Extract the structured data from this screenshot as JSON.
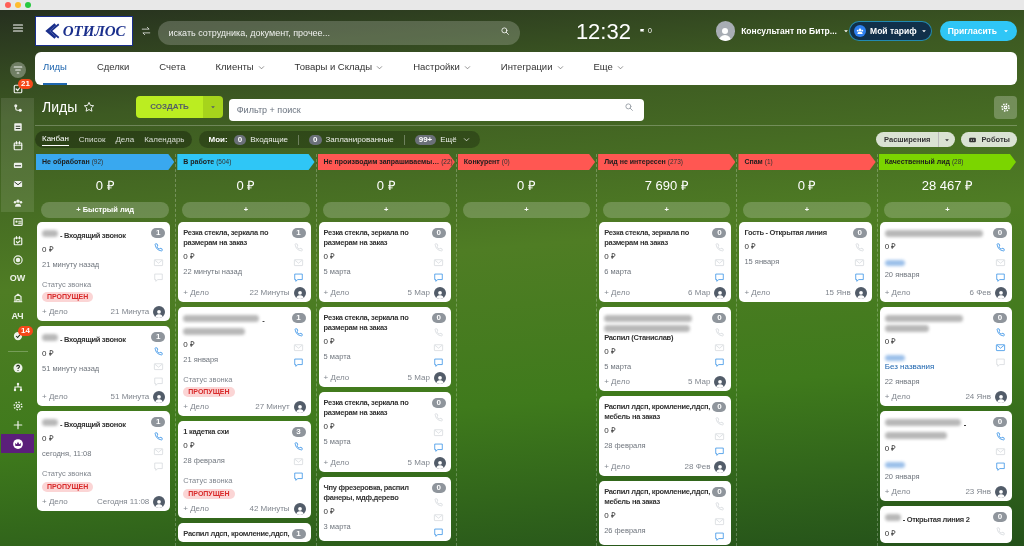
{
  "header": {
    "logo": "ОТИЛОС",
    "search": {
      "placeholder": "искать сотрудника, документ, прочее..."
    },
    "clock": "12:32",
    "flag_count": "0",
    "user": "Консультант по Битр...",
    "tariff": "Мой тариф",
    "invite": "Пригласить"
  },
  "sidebar": [
    {
      "selected": false
    },
    {
      "selected": false,
      "badge": "21"
    },
    {
      "selected": false
    },
    {
      "selected": false
    },
    {
      "selected": false
    },
    {
      "selected": false
    },
    {
      "selected": false
    },
    {
      "selected": false
    },
    {
      "selected": false
    },
    {
      "selected": false
    },
    {
      "selected": false
    },
    {
      "selected": false,
      "label": "OW"
    },
    {
      "selected": false
    },
    {
      "selected": false,
      "label": "АЧ"
    },
    {
      "selected": false,
      "badge": "14"
    },
    {
      "selected": false
    },
    {
      "selected": false
    },
    {
      "selected": false
    },
    {
      "selected": false
    },
    {
      "selected": true
    }
  ],
  "nav": [
    {
      "label": "Лиды",
      "selected": true,
      "menu": false
    },
    {
      "label": "Сделки",
      "selected": false,
      "menu": false
    },
    {
      "label": "Счета",
      "selected": false,
      "menu": false
    },
    {
      "label": "Клиенты",
      "selected": false,
      "menu": true
    },
    {
      "label": "Товары и Склады",
      "selected": false,
      "menu": true
    },
    {
      "label": "Настройки",
      "selected": false,
      "menu": true
    },
    {
      "label": "Интеграции",
      "selected": false,
      "menu": true
    },
    {
      "label": "Еще",
      "selected": false,
      "menu": true
    }
  ],
  "page": {
    "title": "Лиды",
    "create": "СОЗДАТЬ",
    "filter": {
      "placeholder": "Фильтр + поиск"
    }
  },
  "views": [
    {
      "label": "Канбан",
      "selected": true
    },
    {
      "label": "Список",
      "selected": false
    },
    {
      "label": "Дела",
      "selected": false
    },
    {
      "label": "Календарь",
      "selected": false
    }
  ],
  "counters": {
    "label": "Мои:",
    "items": [
      {
        "count": "0",
        "label": "Входящие"
      },
      {
        "count": "0",
        "label": "Запланированные"
      },
      {
        "count": "99+",
        "label": "Ещё"
      }
    ]
  },
  "extensions": "Расширения",
  "robots": "Роботы",
  "columns": [
    {
      "title": "Не обработан",
      "count": "(92)",
      "color": "#39a8ef",
      "sum": "0 ₽",
      "add": "+ Быстрый лид",
      "cards": [
        {
          "kind": "prefix",
          "title": "- Входящий звонок",
          "counter": "1",
          "amount": "0 ₽",
          "date": "21 минуту назад",
          "status_label": "Статус звонка",
          "status": "ПРОПУЩЕН",
          "phone": true,
          "mail": false,
          "chat": false,
          "task": "+ Дело",
          "time": "21 Минута"
        },
        {
          "kind": "prefix",
          "title": "- Входящий звонок",
          "counter": "1",
          "amount": "0 ₽",
          "date": "51 минуту назад",
          "phone": true,
          "mail": false,
          "chat": false,
          "task": "+ Дело",
          "time": "51 Минута"
        },
        {
          "kind": "prefix",
          "title": "- Входящий звонок",
          "counter": "1",
          "amount": "0 ₽",
          "date": "сегодня, 11:08",
          "status_label": "Статус звонка",
          "status": "ПРОПУЩЕН",
          "phone": true,
          "mail": false,
          "chat": false,
          "task": "+ Дело",
          "time": "Сегодня 11:08"
        }
      ]
    },
    {
      "title": "В работе",
      "count": "(504)",
      "color": "#2fc6f6",
      "sum": "0 ₽",
      "add": "+",
      "cards": [
        {
          "kind": "plain",
          "title": "Резка стекла, зеркала по размерам на заказ",
          "counter": "1",
          "amount": "0 ₽",
          "date": "22 минуты назад",
          "phone": false,
          "mail": false,
          "chat": true,
          "task": "+ Дело",
          "time": "22 Минуты"
        },
        {
          "kind": "middle",
          "title": "-",
          "counter": "1",
          "amount": "0 ₽",
          "date": "21 января",
          "status_label": "Статус звонка",
          "status": "ПРОПУЩЕН",
          "phone": true,
          "mail": false,
          "chat": true,
          "task": "+ Дело",
          "time": "27 Минут"
        },
        {
          "kind": "plain",
          "title": "1 кадетка схи",
          "counter": "3",
          "amount": "0 ₽",
          "date": "28 февраля",
          "status_label": "Статус звонка",
          "status": "ПРОПУЩЕН",
          "phone": true,
          "mail": false,
          "chat": true,
          "task": "+ Дело",
          "time": "42 Минуты"
        },
        {
          "kind": "plain",
          "title": "Распил лдсп, кромление,лдсп,",
          "counter": "1"
        }
      ]
    },
    {
      "title": "Не производим запрашиваемы…",
      "count": "(22)",
      "color": "#ff5752",
      "sum": "0 ₽",
      "add": "+",
      "cards": [
        {
          "kind": "plain",
          "title": "Резка стекла, зеркала по размерам на заказ",
          "counter": "0",
          "amount": "0 ₽",
          "date": "5 марта",
          "phone": false,
          "mail": false,
          "chat": true,
          "task": "+ Дело",
          "time": "5 Мар"
        },
        {
          "kind": "plain",
          "title": "Резка стекла, зеркала по размерам на заказ",
          "counter": "0",
          "amount": "0 ₽",
          "date": "5 марта",
          "phone": false,
          "mail": false,
          "chat": true,
          "task": "+ Дело",
          "time": "5 Мар"
        },
        {
          "kind": "plain",
          "title": "Резка стекла, зеркала по размерам на заказ",
          "counter": "0",
          "amount": "0 ₽",
          "date": "5 марта",
          "phone": false,
          "mail": false,
          "chat": true,
          "task": "+ Дело",
          "time": "5 Мар"
        },
        {
          "kind": "plain",
          "title": "Чпу фрезеровка, распил фанеры, мдф,дерево",
          "counter": "0",
          "amount": "0 ₽",
          "date": "3 марта",
          "phone": false,
          "mail": false,
          "chat": true
        }
      ]
    },
    {
      "title": "Конкурент",
      "count": "(0)",
      "color": "#ff5752",
      "sum": "0 ₽",
      "add": "+"
    },
    {
      "title": "Лид не интересен",
      "count": "(273)",
      "color": "#ff5752",
      "sum": "7 690 ₽",
      "add": "+",
      "cards": [
        {
          "kind": "plain",
          "title": "Резка стекла, зеркала по размерам на заказ",
          "counter": "0",
          "amount": "0 ₽",
          "date": "6 марта",
          "phone": false,
          "mail": false,
          "chat": true,
          "task": "+ Дело",
          "time": "6 Мар"
        },
        {
          "kind": "before",
          "title": "Распил (Станислав)",
          "counter": "0",
          "amount": "0 ₽",
          "date": "5 марта",
          "phone": false,
          "mail": false,
          "chat": true,
          "task": "+ Дело",
          "time": "5 Мар"
        },
        {
          "kind": "plain",
          "title": "Распил лдсп, кромление,лдсп, мебель на заказ",
          "counter": "0",
          "amount": "0 ₽",
          "date": "28 февраля",
          "phone": false,
          "mail": false,
          "chat": true,
          "task": "+ Дело",
          "time": "28 Фев"
        },
        {
          "kind": "plain",
          "title": "Распил лдсп, кромление,лдсп, мебель на заказ",
          "counter": "0",
          "amount": "0 ₽",
          "date": "26 февраля",
          "phone": false,
          "mail": false,
          "chat": true
        }
      ]
    },
    {
      "title": "Спам",
      "count": "(1)",
      "color": "#ff5752",
      "sum": "0 ₽",
      "add": "+",
      "cards": [
        {
          "kind": "plain",
          "title": "Гость - Открытая линия",
          "counter": "0",
          "amount": "0 ₽",
          "date": "15 января",
          "phone": false,
          "mail": false,
          "chat": true,
          "task": "+ Дело",
          "time": "15 Янв"
        }
      ]
    },
    {
      "title": "Качественный лид",
      "count": "(28)",
      "color": "#7bd500",
      "sum": "28 467 ₽",
      "add": "+",
      "cards": [
        {
          "kind": "single",
          "counter": "0",
          "amount": "0 ₽",
          "link_redacted": true,
          "date": "20 января",
          "phone": true,
          "mail": false,
          "chat": true,
          "task": "+ Дело",
          "time": "6 Фев"
        },
        {
          "kind": "full",
          "counter": "0",
          "amount": "0 ₽",
          "link_redacted": true,
          "link": "Без названия",
          "date": "22 января",
          "phone": true,
          "mail": true,
          "chat": false,
          "task": "+ Дело",
          "time": "24 Янв"
        },
        {
          "kind": "middle",
          "title": "-",
          "counter": "0",
          "amount": "0 ₽",
          "link_redacted": true,
          "date": "20 января",
          "phone": true,
          "mail": false,
          "chat": true,
          "task": "+ Дело",
          "time": "23 Янв"
        },
        {
          "kind": "prefix",
          "title": "- Открытая линия 2",
          "counter": "0",
          "amount": "0 ₽",
          "phone": false
        }
      ]
    }
  ]
}
